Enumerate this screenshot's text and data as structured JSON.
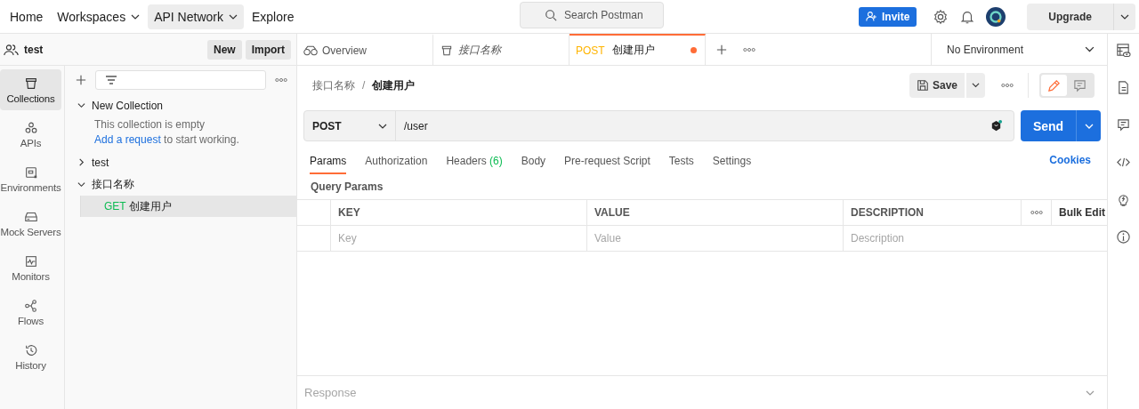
{
  "topnav": {
    "items": [
      {
        "label": "Home",
        "dropdown": false,
        "selected": false
      },
      {
        "label": "Workspaces",
        "dropdown": true,
        "selected": false
      },
      {
        "label": "API Network",
        "dropdown": true,
        "selected": true
      },
      {
        "label": "Explore",
        "dropdown": false,
        "selected": false
      }
    ],
    "search": {
      "placeholder": "Search Postman"
    },
    "invite": "Invite",
    "upgrade": "Upgrade"
  },
  "workspace": {
    "name": "test",
    "buttons": [
      "New",
      "Import"
    ]
  },
  "rail": [
    {
      "label": "Collections",
      "kind": "collections",
      "selected": true
    },
    {
      "label": "APIs",
      "kind": "apis",
      "selected": false
    },
    {
      "label": "Environments",
      "kind": "environments",
      "selected": false
    },
    {
      "label": "Mock Servers",
      "kind": "mock",
      "selected": false
    },
    {
      "label": "Monitors",
      "kind": "monitors",
      "selected": false
    },
    {
      "label": "Flows",
      "kind": "flows",
      "selected": false
    },
    {
      "label": "History",
      "kind": "history",
      "selected": false
    }
  ],
  "tree": [
    {
      "name": "New Collection",
      "expanded": true,
      "empty_text": "This collection is empty",
      "empty_link": "Add a request",
      "empty_rest": " to start working."
    },
    {
      "name": "test",
      "expanded": false
    },
    {
      "name": "接口名称",
      "expanded": true,
      "children": [
        {
          "method": "GET",
          "name": "创建用户",
          "selected": true
        }
      ]
    }
  ],
  "tabs": [
    {
      "kind": "overview",
      "label": "Overview",
      "selected": false
    },
    {
      "kind": "collection",
      "label": "接口名称",
      "selected": false
    },
    {
      "kind": "request",
      "method": "POST",
      "label": "创建用户",
      "selected": true,
      "unsaved": true
    }
  ],
  "environment": "No Environment",
  "breadcrumb": {
    "parent": "接口名称",
    "separator": "/",
    "current": "创建用户"
  },
  "save": "Save",
  "mode_toggle": [
    {
      "kind": "edit",
      "selected": true
    },
    {
      "kind": "comments",
      "selected": false
    }
  ],
  "request": {
    "method": "POST",
    "url": "/user",
    "send": "Send"
  },
  "subtabs": [
    {
      "label": "Params",
      "selected": true
    },
    {
      "label": "Authorization",
      "selected": false
    },
    {
      "label": "Headers",
      "count": "(6)",
      "selected": false
    },
    {
      "label": "Body",
      "selected": false
    },
    {
      "label": "Pre-request Script",
      "selected": false
    },
    {
      "label": "Tests",
      "selected": false
    },
    {
      "label": "Settings",
      "selected": false
    }
  ],
  "cookies": "Cookies",
  "query_title": "Query Params",
  "params_table": {
    "columns": [
      "KEY",
      "VALUE",
      "DESCRIPTION"
    ],
    "bulk_edit": "Bulk Edit",
    "placeholders": [
      "Key",
      "Value",
      "Description"
    ]
  },
  "response": "Response"
}
